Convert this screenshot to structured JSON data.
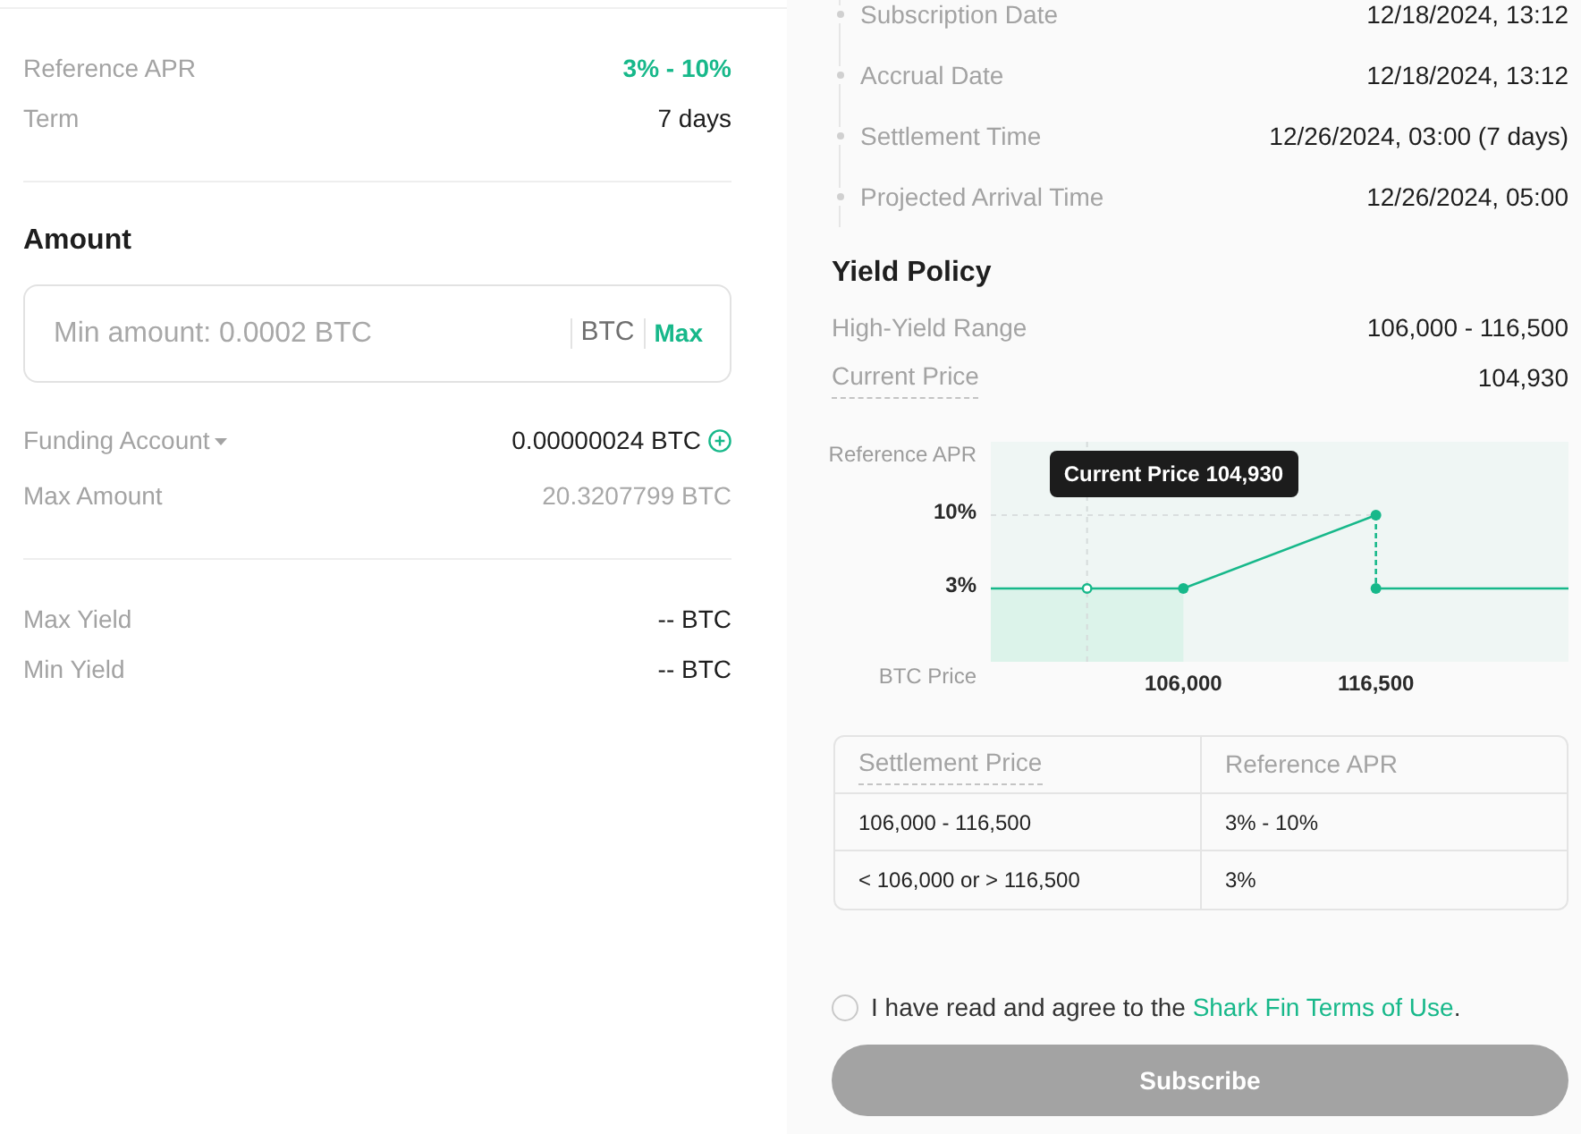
{
  "summary": {
    "rows": [
      {
        "label": "Reference APR",
        "value": "3% - 10%",
        "kind": "highlight"
      },
      {
        "label": "Term",
        "value": "7 days",
        "kind": "plain"
      }
    ]
  },
  "amount": {
    "heading": "Amount",
    "input": {
      "placeholder": "Min amount: 0.0002 BTC",
      "unit": "BTC",
      "max_button": "Max"
    },
    "funding_account": {
      "label": "Funding Account",
      "value": "0.00000024 BTC"
    },
    "max_amount": {
      "label": "Max Amount",
      "value": "20.3207799 BTC"
    }
  },
  "yields": [
    {
      "label": "Max Yield",
      "value": "-- BTC"
    },
    {
      "label": "Min Yield",
      "value": "-- BTC"
    }
  ],
  "timeline": [
    {
      "label": "Subscription Date",
      "value": "12/18/2024, 13:12"
    },
    {
      "label": "Accrual Date",
      "value": "12/18/2024, 13:12"
    },
    {
      "label": "Settlement Time",
      "value": "12/26/2024, 03:00 (7 days)"
    },
    {
      "label": "Projected Arrival Time",
      "value": "12/26/2024, 05:00"
    }
  ],
  "yield_policy": {
    "heading": "Yield Policy",
    "rows": [
      {
        "label": "High-Yield Range",
        "value": "106,000 - 116,500",
        "kind": "plain"
      },
      {
        "label": "Current Price",
        "value": "104,930",
        "kind": "term"
      }
    ],
    "chart_data": {
      "type": "line",
      "xlabel": "BTC Price",
      "ylabel": "Reference APR",
      "x": [
        95500,
        106000,
        116500,
        116500,
        127000
      ],
      "series": [
        {
          "color": "#17b88a",
          "marker": "circle",
          "line_style": "dashed_drop",
          "values": [
            3,
            3,
            10,
            3,
            3
          ]
        }
      ],
      "xlim": [
        95500,
        127000
      ],
      "ylim": [
        -4,
        17
      ],
      "xticks": [
        {
          "value": 106000,
          "label": "106,000"
        },
        {
          "value": 116500,
          "label": "116,500"
        }
      ],
      "yticks": [
        {
          "value": 3,
          "label": "3%"
        },
        {
          "value": 10,
          "label": "10%"
        }
      ],
      "bands": [
        {
          "axis": "x",
          "from": 95500,
          "to": 106000
        }
      ],
      "ref_lines": [
        {
          "axis": "y",
          "value": 10
        },
        {
          "axis": "x",
          "value": 100750
        }
      ],
      "annotations": [
        "Current Price 104,930"
      ]
    },
    "table": {
      "columns": [
        {
          "label": "Settlement Price",
          "kind": "term"
        },
        {
          "label": "Reference APR",
          "kind": "plain"
        }
      ],
      "rows": [
        [
          "106,000 - 116,500",
          "3% - 10%"
        ],
        [
          "< 106,000 or > 116,500",
          "3%"
        ]
      ]
    }
  },
  "agreement": {
    "checked": false,
    "text": "I have read and agree to the ",
    "link": "Shark Fin Terms of Use",
    "after_link": "."
  },
  "subscribe_button": {
    "label": "Subscribe",
    "disabled": true
  }
}
